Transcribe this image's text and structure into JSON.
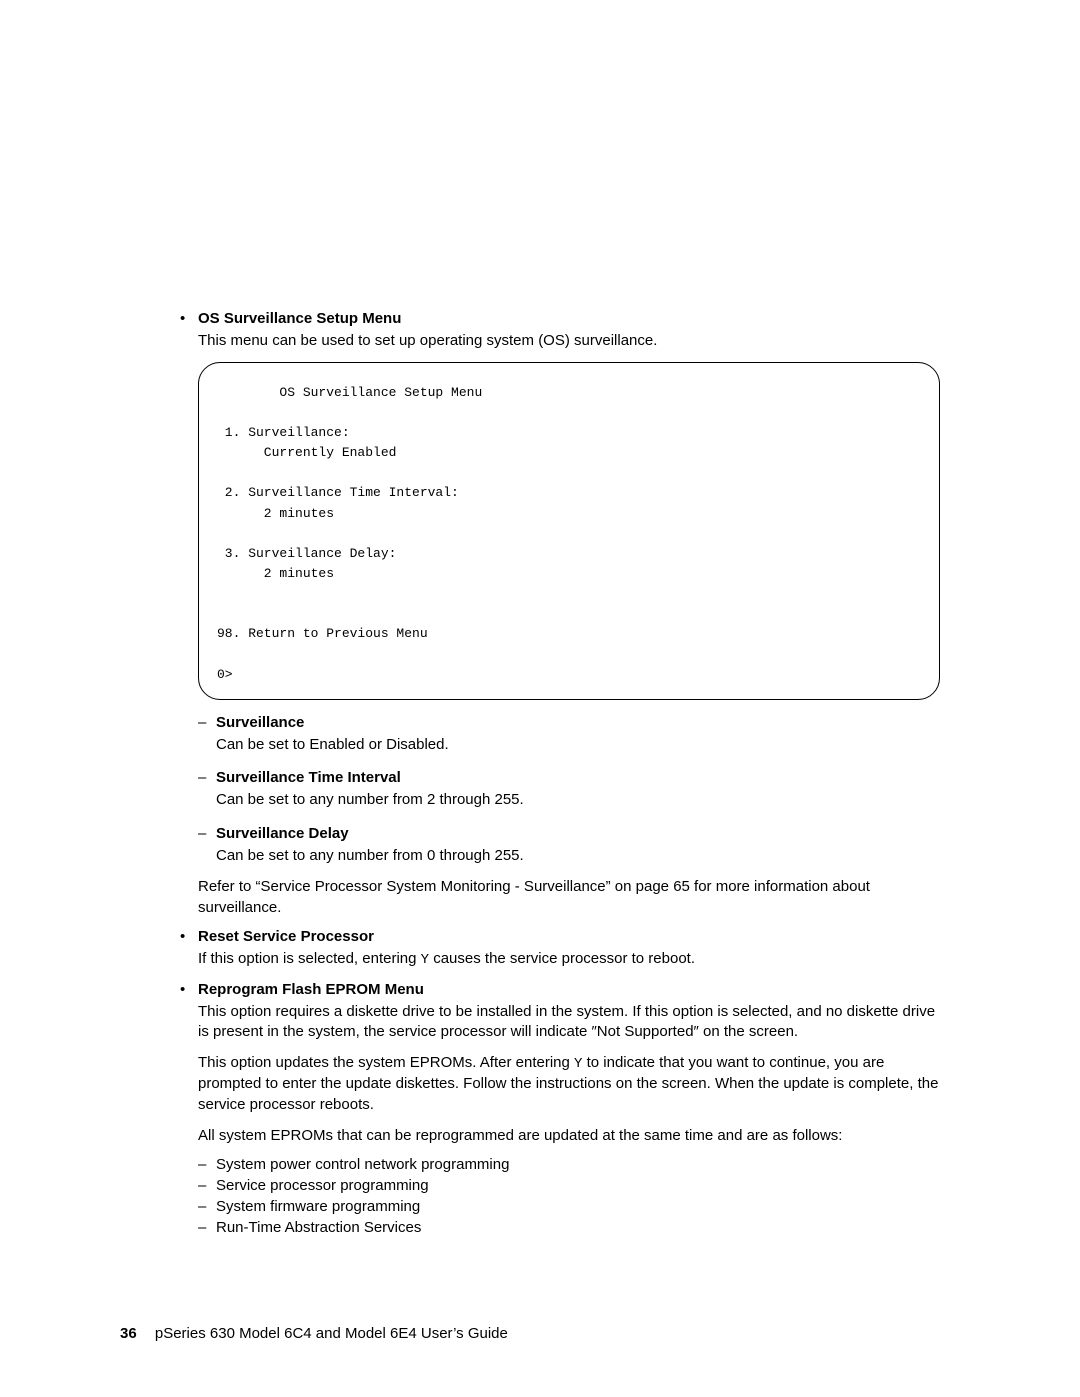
{
  "section1": {
    "title": "OS Surveillance Setup Menu",
    "intro": "This menu can be used to set up operating system (OS) surveillance.",
    "terminal": "        OS Surveillance Setup Menu\n\n 1. Surveillance:\n      Currently Enabled\n\n 2. Surveillance Time Interval:\n      2 minutes\n\n 3. Surveillance Delay:\n      2 minutes\n\n\n98. Return to Previous Menu\n\n0>",
    "items": [
      {
        "title": "Surveillance",
        "desc": "Can be set to Enabled or Disabled."
      },
      {
        "title": "Surveillance Time Interval",
        "desc": "Can be set to any number from 2 through 255."
      },
      {
        "title": "Surveillance Delay",
        "desc": "Can be set to any number from 0 through 255."
      }
    ],
    "refer": "Refer to “Service Processor System Monitoring - Surveillance” on page 65 for more information about surveillance."
  },
  "section2": {
    "title": "Reset Service Processor",
    "desc_pre": "If this option is selected, entering ",
    "desc_code": "Y",
    "desc_post": " causes the service processor to reboot."
  },
  "section3": {
    "title": "Reprogram Flash EPROM Menu",
    "p1": "This option requires a diskette drive to be installed in the system. If this option is selected, and no diskette drive is present in the system, the service processor will indicate ″Not Supported″ on the screen.",
    "p2_pre": "This option updates the system EPROMs. After entering ",
    "p2_code": "Y",
    "p2_post": " to indicate that you want to continue, you are prompted to enter the update diskettes. Follow the instructions on the screen. When the update is complete, the service processor reboots.",
    "p3": "All system EPROMs that can be reprogrammed are updated at the same time and are as follows:",
    "eprom_items": [
      "System power control network programming",
      "Service processor programming",
      "System firmware programming",
      "Run-Time Abstraction Services"
    ]
  },
  "footer": {
    "page": "36",
    "title": "pSeries 630 Model 6C4 and Model 6E4 User’s Guide"
  }
}
